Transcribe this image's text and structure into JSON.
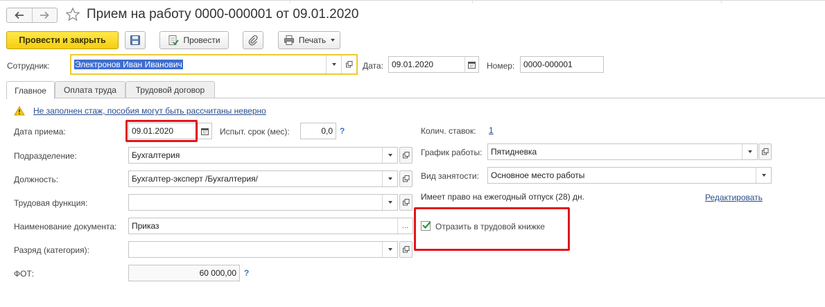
{
  "window": {
    "title": "Прием на работу 0000-000001 от 09.01.2020"
  },
  "toolbar": {
    "post_close": "Провести и закрыть",
    "post": "Провести",
    "print": "Печать"
  },
  "header": {
    "employee_label": "Сотрудник:",
    "employee_value": "Электронов Иван Иванович",
    "date_label": "Дата:",
    "date_value": "09.01.2020",
    "number_label": "Номер:",
    "number_value": "0000-000001"
  },
  "tabs": [
    {
      "label": "Главное"
    },
    {
      "label": "Оплата труда"
    },
    {
      "label": "Трудовой договор"
    }
  ],
  "warning": {
    "text": "Не заполнен стаж, пособия могут быть рассчитаны неверно"
  },
  "main": {
    "hire_date_label": "Дата приема:",
    "hire_date_value": "09.01.2020",
    "probation_label": "Испыт. срок (мес):",
    "probation_value": "0,0",
    "help_mark": "?",
    "rates_label": "Колич. ставок:",
    "rates_value": "1",
    "department_label": "Подразделение:",
    "department_value": "Бухгалтерия",
    "schedule_label": "График работы:",
    "schedule_value": "Пятидневка",
    "position_label": "Должность:",
    "position_value": "Бухгалтер-эксперт /Бухгалтерия/",
    "employment_label": "Вид занятости:",
    "employment_value": "Основное место работы",
    "labor_function_label": "Трудовая функция:",
    "labor_function_value": "",
    "vacation_text": "Имеет право на ежегодный отпуск (28) дн.",
    "edit_link": "Редактировать",
    "doc_name_label": "Наименование документа:",
    "doc_name_value": "Приказ",
    "reflect_label": "Отразить в трудовой книжке",
    "reflect_checked": true,
    "grade_label": "Разряд (категория):",
    "grade_value": "",
    "fot_label": "ФОТ:",
    "fot_value": "60 000,00",
    "ellipsis": "..."
  },
  "colors": {
    "primary_button": "#f5cd10",
    "highlight": "#e3141b",
    "link": "#2a4e8c",
    "selection": "#3d6dd1",
    "check": "#2f8f3a"
  }
}
